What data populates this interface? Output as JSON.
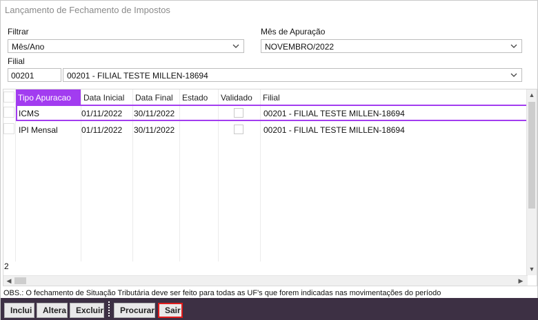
{
  "window": {
    "title": "Lançamento de Fechamento de Impostos"
  },
  "filter": {
    "label": "Filtrar",
    "value": "Mês/Ano"
  },
  "period": {
    "label": "Mês de Apuração",
    "value": "NOVEMBRO/2022"
  },
  "branch": {
    "label": "Filial",
    "code": "00201",
    "name": "00201 - FILIAL TESTE MILLEN-18694"
  },
  "grid": {
    "columns": [
      "Tipo Apuracao",
      "Data Inicial",
      "Data Final",
      "Estado",
      "Validado",
      "Filial"
    ],
    "rows": [
      {
        "tipo": "ICMS",
        "inicio": "01/11/2022",
        "fim": "30/11/2022",
        "estado": "",
        "validado": false,
        "filial": "00201 - FILIAL TESTE MILLEN-18694",
        "selected": true
      },
      {
        "tipo": "IPI Mensal",
        "inicio": "01/11/2022",
        "fim": "30/11/2022",
        "estado": "",
        "validado": false,
        "filial": "00201 - FILIAL TESTE MILLEN-18694",
        "selected": false
      }
    ],
    "count": "2"
  },
  "note": "OBS.: O fechamento de Situação Tributária deve ser feito para todas as UF's que forem indicadas nas movimentações do período",
  "toolbar": {
    "incluir": "Inclui",
    "alterar": "Altera",
    "excluir": "Excluir",
    "procurar": "Procurar",
    "sair": "Sair"
  },
  "colors": {
    "accent": "#a23cf0",
    "toolbar_bg": "#3d3044",
    "exit_outline": "#e11b1b"
  }
}
